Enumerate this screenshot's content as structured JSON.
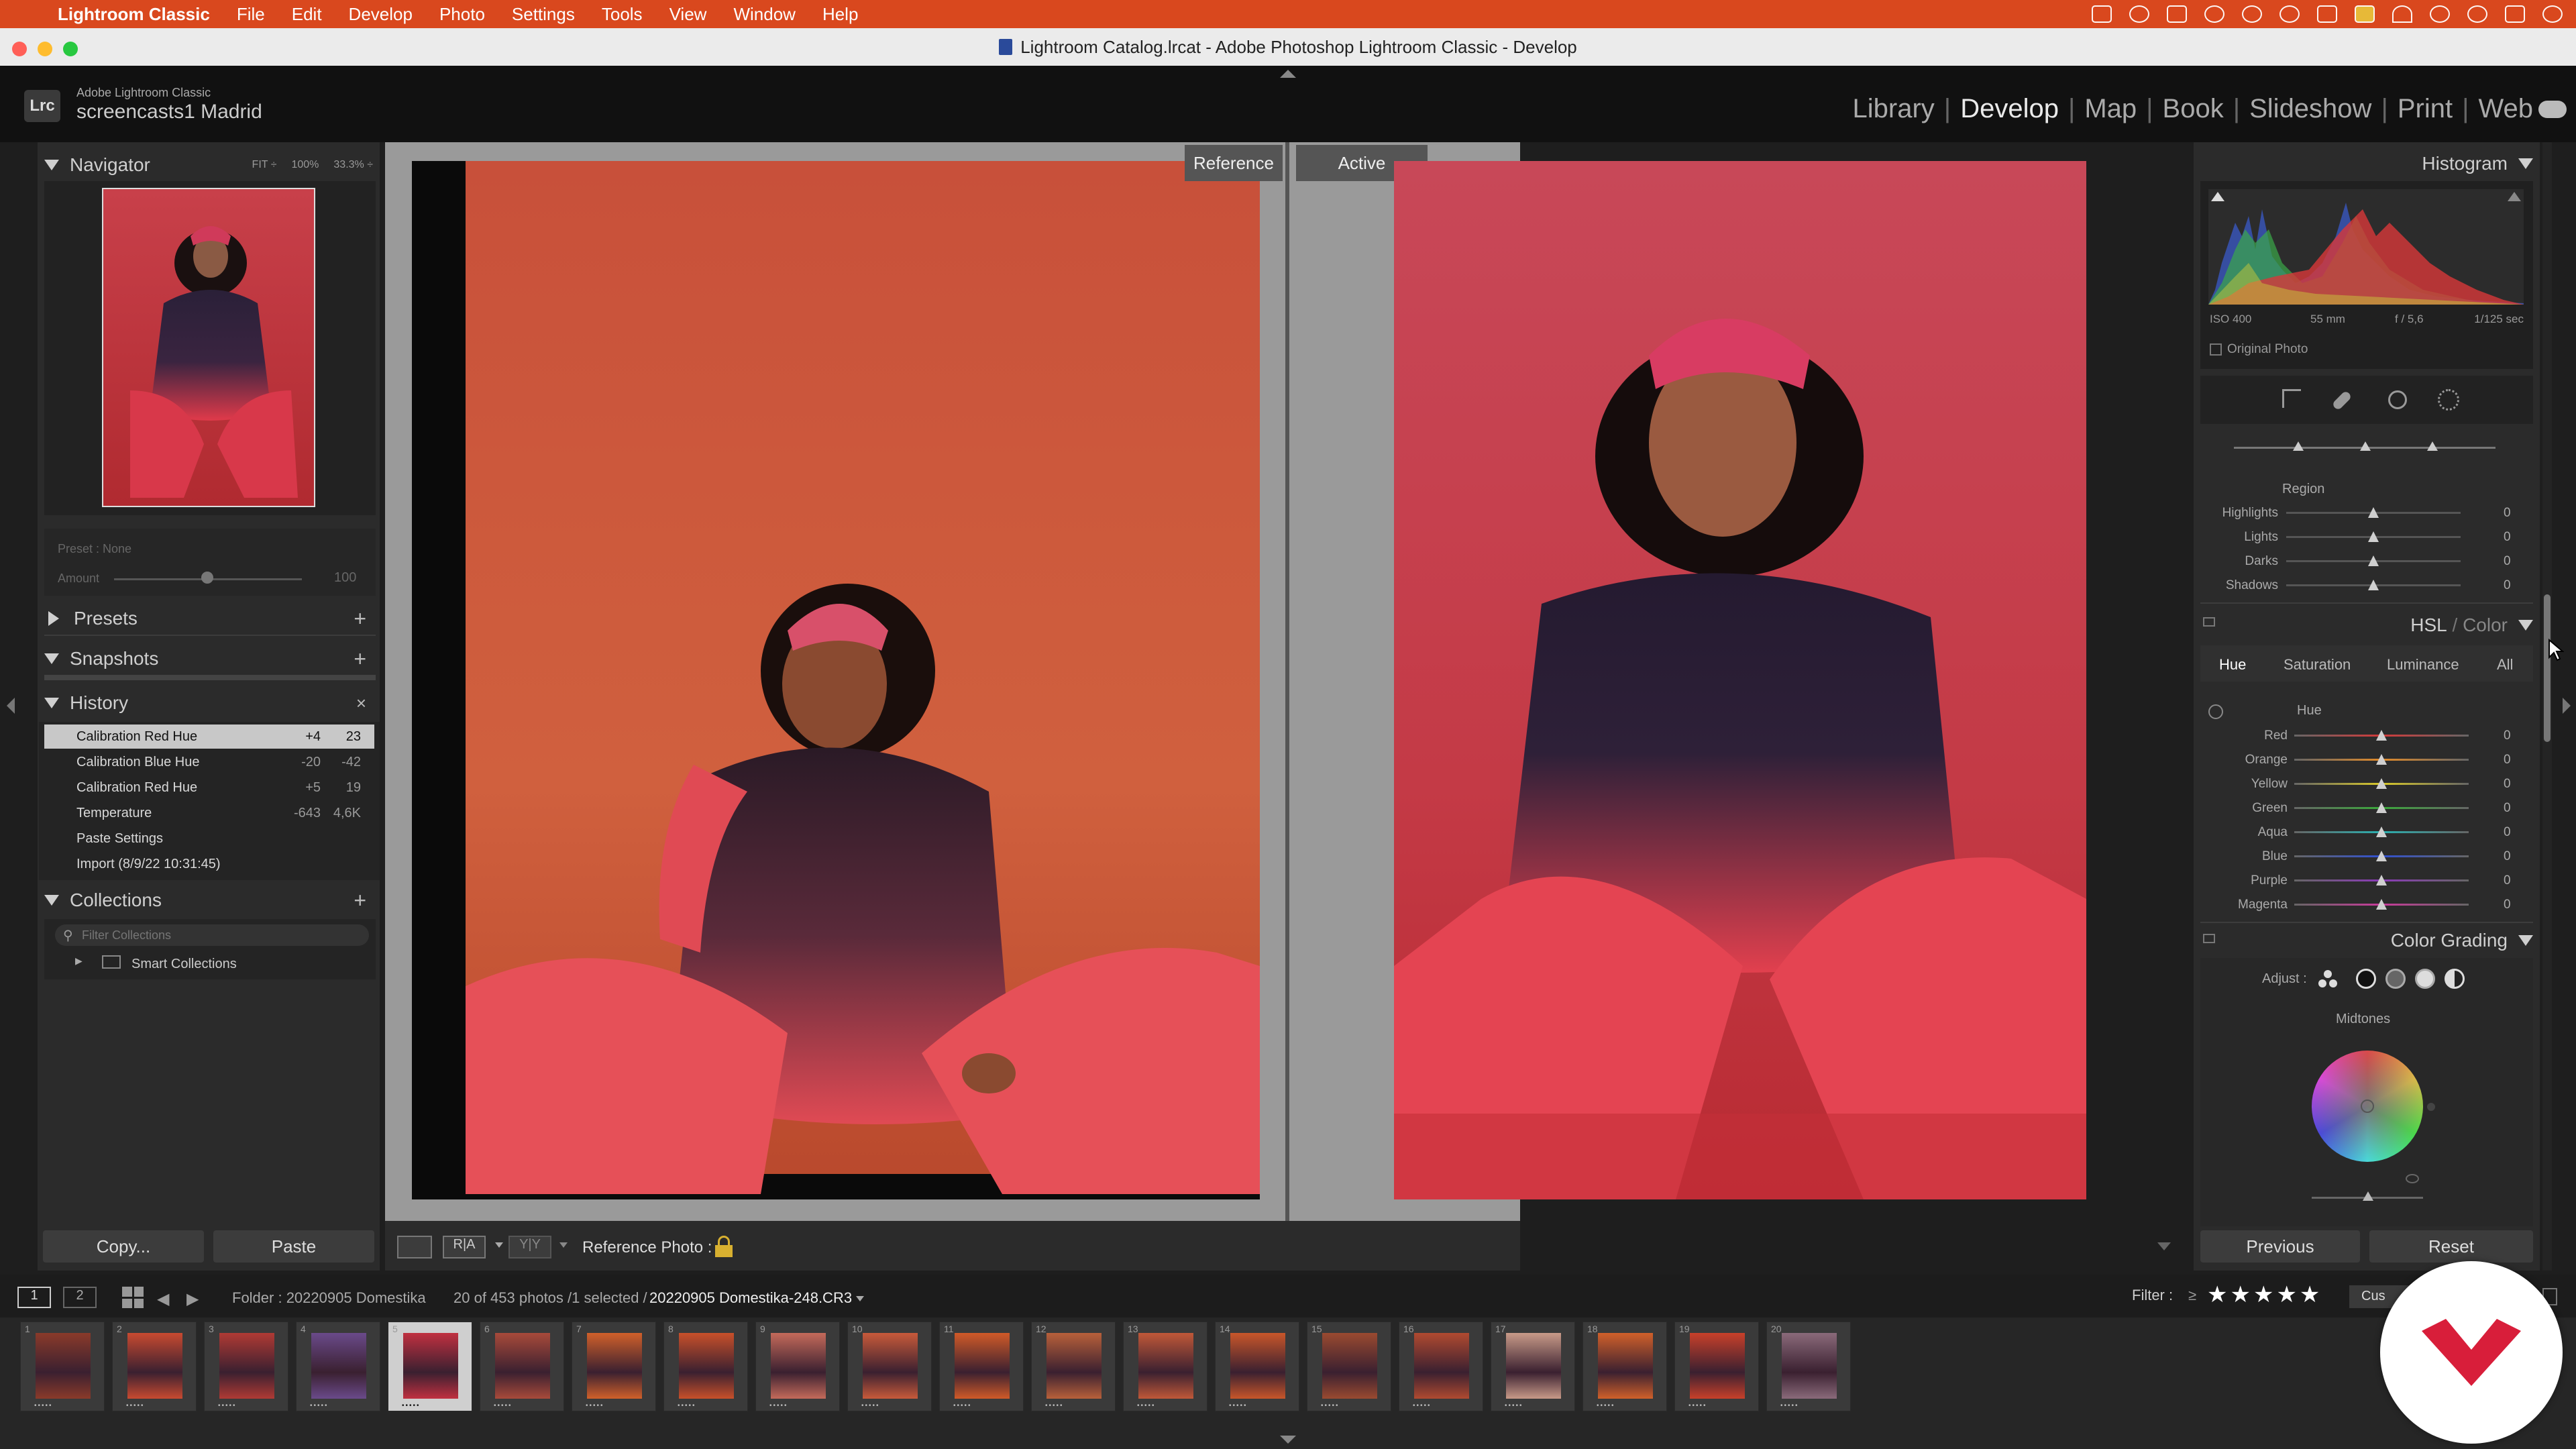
{
  "menubar": {
    "app": "Lightroom Classic",
    "items": [
      "File",
      "Edit",
      "Develop",
      "Photo",
      "Settings",
      "Tools",
      "View",
      "Window",
      "Help"
    ],
    "color": "#d9481e"
  },
  "window": {
    "title": "Lightroom Catalog.lrcat - Adobe Photoshop Lightroom Classic - Develop"
  },
  "identity": {
    "logo": "Lrc",
    "app_name": "Adobe Lightroom Classic",
    "catalog_name": "screencasts1 Madrid"
  },
  "modules": [
    {
      "label": "Library",
      "active": false
    },
    {
      "label": "Develop",
      "active": true
    },
    {
      "label": "Map",
      "active": false
    },
    {
      "label": "Book",
      "active": false
    },
    {
      "label": "Slideshow",
      "active": false
    },
    {
      "label": "Print",
      "active": false
    },
    {
      "label": "Web",
      "active": false
    }
  ],
  "left_panel": {
    "navigator": {
      "title": "Navigator",
      "zoom_options": [
        "FIT ÷",
        "100%",
        "33.3% ÷"
      ]
    },
    "preset": {
      "label": "Preset : None",
      "amount_label": "Amount",
      "amount_value": "100",
      "amount_fraction": 0.5
    },
    "presets": {
      "title": "Presets"
    },
    "snapshots": {
      "title": "Snapshots"
    },
    "history": {
      "title": "History",
      "close": "×",
      "items": [
        {
          "label": "Calibration Red Hue",
          "v1": "+4",
          "v2": "23",
          "selected": true
        },
        {
          "label": "Calibration Blue Hue",
          "v1": "-20",
          "v2": "-42",
          "selected": false
        },
        {
          "label": "Calibration Red Hue",
          "v1": "+5",
          "v2": "19",
          "selected": false
        },
        {
          "label": "Temperature",
          "v1": "-643",
          "v2": "4,6K",
          "selected": false
        },
        {
          "label": "Paste Settings",
          "v1": "",
          "v2": "",
          "selected": false
        },
        {
          "label": "Import (8/9/22 10:31:45)",
          "v1": "",
          "v2": "",
          "selected": false
        }
      ]
    },
    "collections": {
      "title": "Collections",
      "filter_placeholder": "Filter Collections",
      "smart_collections": "Smart Collections"
    },
    "copy_label": "Copy...",
    "paste_label": "Paste"
  },
  "center": {
    "reference_label": "Reference",
    "active_label": "Active",
    "toolbar": {
      "reference_photo_label": "Reference Photo :"
    }
  },
  "right_panel": {
    "histogram": {
      "title": "Histogram",
      "iso": "ISO 400",
      "focal": "55 mm",
      "aperture": "f / 5,6",
      "shutter": "1/125 sec",
      "original_photo": "Original Photo"
    },
    "region": {
      "title": "Region",
      "sliders": [
        {
          "name": "Highlights",
          "value": "0",
          "fraction": 0.5
        },
        {
          "name": "Lights",
          "value": "0",
          "fraction": 0.5
        },
        {
          "name": "Darks",
          "value": "0",
          "fraction": 0.5
        },
        {
          "name": "Shadows",
          "value": "0",
          "fraction": 0.5
        }
      ]
    },
    "hsl": {
      "title_a": "HSL",
      "title_sep": " / ",
      "title_b": "Color",
      "tabs": [
        "Hue",
        "Saturation",
        "Luminance",
        "All"
      ],
      "active_tab": "Hue",
      "section": "Hue",
      "sliders": [
        {
          "name": "Red",
          "value": "0",
          "fraction": 0.5,
          "color": "#d23a3a"
        },
        {
          "name": "Orange",
          "value": "0",
          "fraction": 0.5,
          "color": "#e08a2a"
        },
        {
          "name": "Yellow",
          "value": "0",
          "fraction": 0.5,
          "color": "#d8c82a"
        },
        {
          "name": "Green",
          "value": "0",
          "fraction": 0.5,
          "color": "#3aa83a"
        },
        {
          "name": "Aqua",
          "value": "0",
          "fraction": 0.5,
          "color": "#2ab0b0"
        },
        {
          "name": "Blue",
          "value": "0",
          "fraction": 0.5,
          "color": "#3050d0"
        },
        {
          "name": "Purple",
          "value": "0",
          "fraction": 0.5,
          "color": "#8a3ab8"
        },
        {
          "name": "Magenta",
          "value": "0",
          "fraction": 0.5,
          "color": "#c83a9a"
        }
      ]
    },
    "color_grading": {
      "title": "Color Grading",
      "adjust_label": "Adjust :",
      "section": "Midtones"
    },
    "previous_label": "Previous",
    "reset_label": "Reset"
  },
  "filmstrip_bar": {
    "page1": "1",
    "page2": "2",
    "folder": "Folder : 20220905 Domestika",
    "count": "20 of 453 photos /1 selected /",
    "filename": "20220905 Domestika-248.CR3",
    "filter_label": "Filter :",
    "filter_op": "≥",
    "stars": "★★★★★",
    "filter_preset": "Cus"
  },
  "filmstrip": {
    "selected_index": 5,
    "thumbs": [
      {
        "n": "1",
        "c": "#8a3a2a"
      },
      {
        "n": "2",
        "c": "#c84a30"
      },
      {
        "n": "3",
        "c": "#b03a34"
      },
      {
        "n": "4",
        "c": "#6a4a8a"
      },
      {
        "n": "5",
        "c": "#c03040"
      },
      {
        "n": "6",
        "c": "#a84a3a"
      },
      {
        "n": "7",
        "c": "#d0602a"
      },
      {
        "n": "8",
        "c": "#c8502a"
      },
      {
        "n": "9",
        "c": "#c46a5a"
      },
      {
        "n": "10",
        "c": "#c85a3a"
      },
      {
        "n": "11",
        "c": "#d05a28"
      },
      {
        "n": "12",
        "c": "#b8603a"
      },
      {
        "n": "13",
        "c": "#c05838"
      },
      {
        "n": "14",
        "c": "#c8562a"
      },
      {
        "n": "15",
        "c": "#9a4a30"
      },
      {
        "n": "16",
        "c": "#b04a30"
      },
      {
        "n": "17",
        "c": "#c89a88"
      },
      {
        "n": "18",
        "c": "#d0602a"
      },
      {
        "n": "19",
        "c": "#c8402a"
      },
      {
        "n": "20",
        "c": "#8a6a7a"
      }
    ]
  },
  "brand_badge": {
    "color": "#d81e3a"
  }
}
